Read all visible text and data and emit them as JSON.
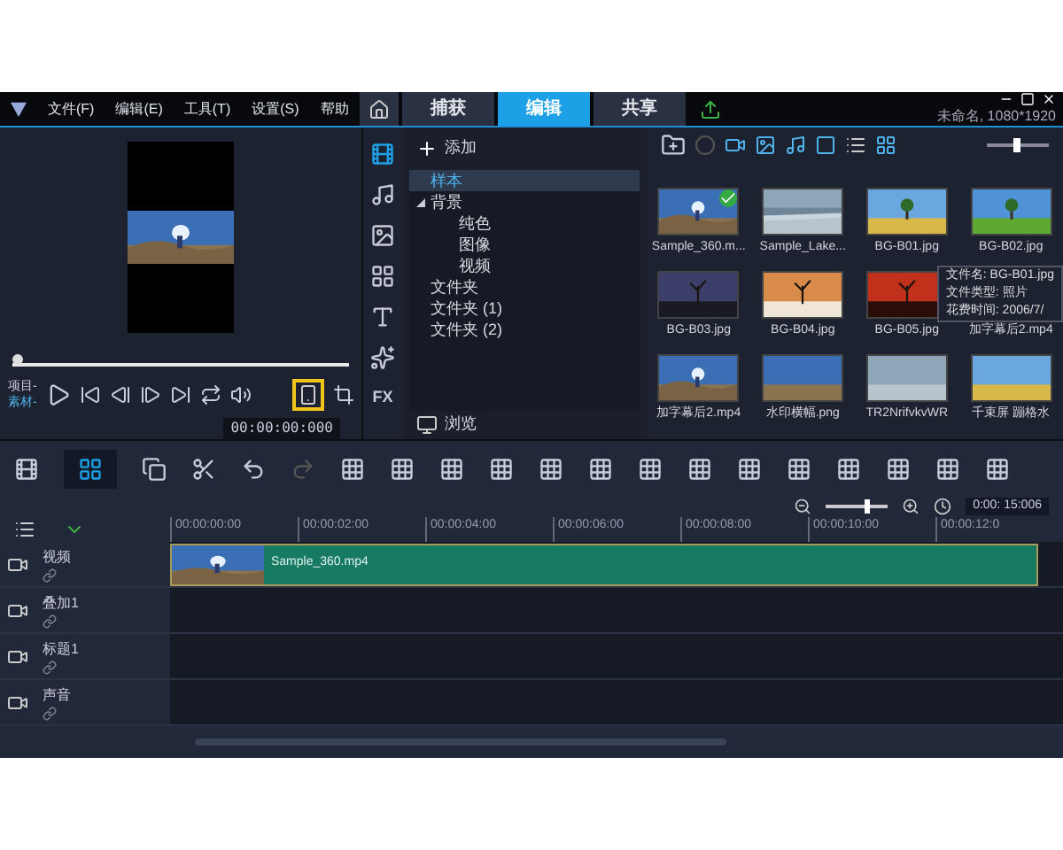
{
  "menu": [
    "文件(F)",
    "编辑(E)",
    "工具(T)",
    "设置(S)",
    "帮助"
  ],
  "tabs": [
    {
      "label": "捕获",
      "selected": false
    },
    {
      "label": "编辑",
      "selected": true
    },
    {
      "label": "共享",
      "selected": false
    }
  ],
  "project_info": "未命名, 1080*1920",
  "fx_label": "FX",
  "player": {
    "project_label": "项目-",
    "clip_label": "素材-",
    "timecode": "00:00:00:000",
    "level": 0
  },
  "library": {
    "add": "添加",
    "browse": "浏览",
    "tree": [
      {
        "label": "样本",
        "selected": true
      },
      {
        "label": "背景",
        "selected": false,
        "expanded": true,
        "children": [
          {
            "label": "纯色",
            "selected": false
          },
          {
            "label": "图像",
            "selected": false
          },
          {
            "label": "视频",
            "selected": false
          }
        ]
      },
      {
        "label": "文件夹",
        "selected": false
      },
      {
        "label": "文件夹 (1)",
        "selected": false
      },
      {
        "label": "文件夹 (2)",
        "selected": false
      }
    ],
    "thumbnails": [
      {
        "label": "Sample_360.m...",
        "checked": true
      },
      {
        "label": "Sample_Lake...",
        "checked": false
      },
      {
        "label": "BG-B01.jpg",
        "checked": false
      },
      {
        "label": "BG-B02.jpg",
        "checked": false
      },
      {
        "label": "BG-B03.jpg",
        "checked": false
      },
      {
        "label": "BG-B04.jpg",
        "checked": false
      },
      {
        "label": "BG-B05.jpg",
        "checked": false
      },
      {
        "label": "加字幕后2.mp4"
      },
      {
        "label": "加字幕后2.mp4",
        "checked": false
      },
      {
        "label": "水印横幅.png",
        "checked": false
      },
      {
        "label": "TR2NrifvkvWR",
        "checked": false
      },
      {
        "label": "千束屏 蹦格水",
        "checked": false
      }
    ],
    "tooltip": [
      "文件名: BG-B01.jpg",
      "文件类型: 照片",
      "花费时间: 2006/7/"
    ]
  },
  "timeline": {
    "ruler": [
      "00:00:00:00",
      "00:00:02:00",
      "00:00:04:00",
      "00:00:06:00",
      "00:00:08:00",
      "00:00:10:00",
      "00:00:12:0"
    ],
    "duration": "0:00: 15:006",
    "zoom": {
      "level": 0.7
    },
    "tracks": [
      {
        "name": "视频",
        "clip": "Sample_360.mp4"
      },
      {
        "name": "叠加1"
      },
      {
        "name": "标题1"
      },
      {
        "name": "声音"
      }
    ]
  }
}
